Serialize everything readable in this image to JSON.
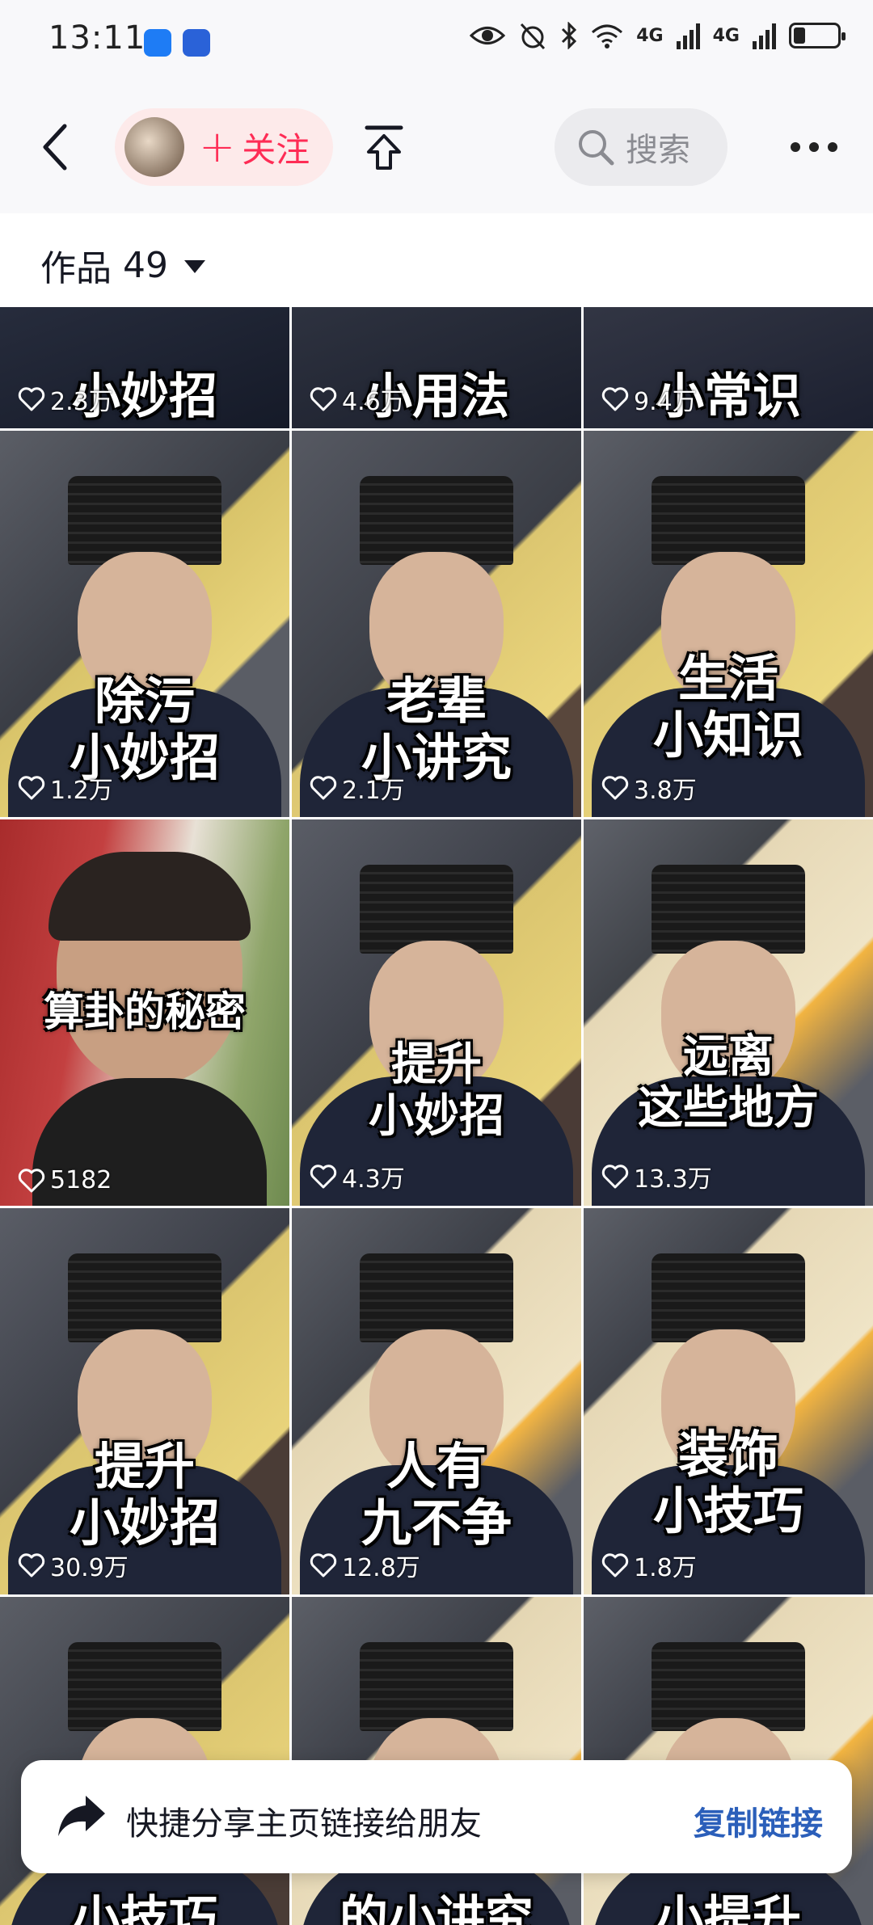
{
  "status_bar": {
    "time": "13:11",
    "network_1": "4G",
    "network_2": "4G"
  },
  "nav": {
    "follow_label": "关注",
    "search_placeholder": "搜索"
  },
  "works": {
    "label": "作品",
    "count": "49"
  },
  "grid": {
    "items": [
      {
        "caption": "小妙招",
        "likes": "2.3万"
      },
      {
        "caption": "小用法",
        "likes": "4.6万"
      },
      {
        "caption": "小常识",
        "likes": "9.4万"
      },
      {
        "caption": "除污\n小妙招",
        "likes": "1.2万"
      },
      {
        "caption": "老辈\n小讲究",
        "likes": "2.1万"
      },
      {
        "caption": "生活\n小知识",
        "likes": "3.8万"
      },
      {
        "caption": "算卦的秘密",
        "likes": "5182"
      },
      {
        "caption": "提升\n小妙招",
        "likes": "4.3万"
      },
      {
        "caption": "远离\n这些地方",
        "likes": "13.3万"
      },
      {
        "caption": "提升\n小妙招",
        "likes": "30.9万"
      },
      {
        "caption": "人有\n九不争",
        "likes": "12.8万"
      },
      {
        "caption": "装饰\n小技巧",
        "likes": "1.8万"
      },
      {
        "caption": "小技巧",
        "likes": ""
      },
      {
        "caption": "的小讲究",
        "likes": ""
      },
      {
        "caption": "小提升",
        "likes": ""
      }
    ]
  },
  "share_banner": {
    "text": "快捷分享主页链接给朋友",
    "button": "复制链接"
  },
  "colors": {
    "accent": "#fe2c55",
    "link": "#2b5fba",
    "pill_bg": "#fdeaea",
    "search_bg": "#ebebee"
  }
}
